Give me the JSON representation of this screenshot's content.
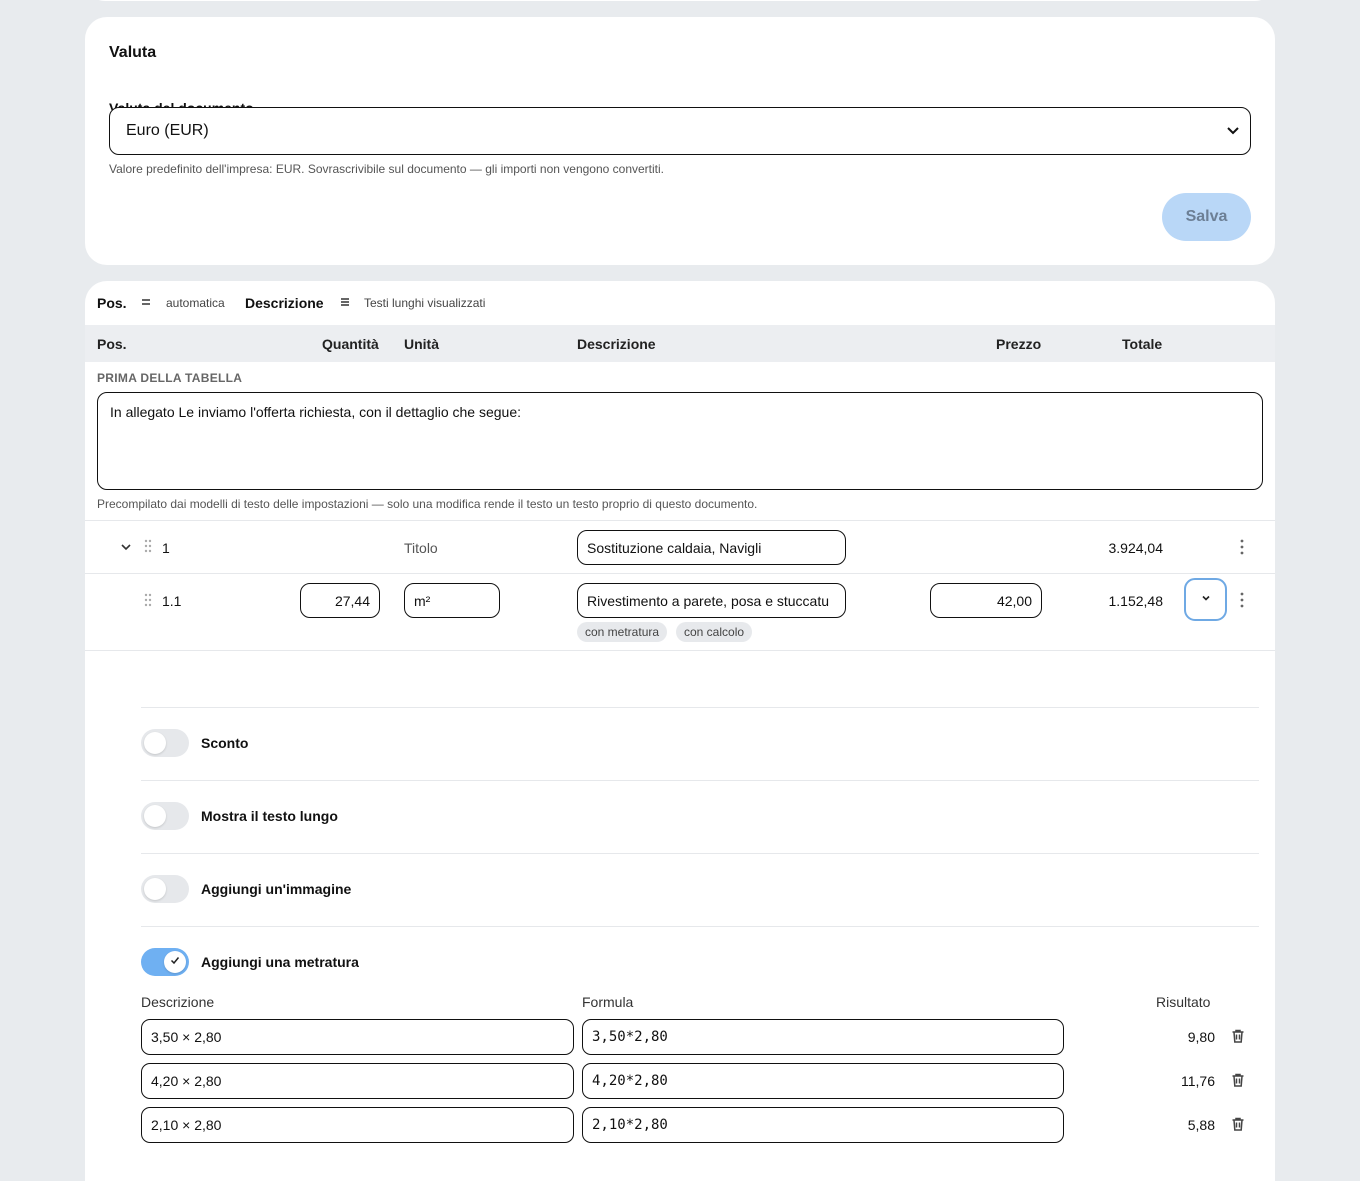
{
  "valuta": {
    "title": "Valuta",
    "field_label": "Valuta del documento",
    "selected": "Euro (EUR)",
    "hint": "Valore predefinito dell'impresa: EUR. Sovrascrivibile sul documento — gli importi non vengono convertiti.",
    "save_label": "Salva"
  },
  "toolbar": {
    "pos_label": "Pos.",
    "pos_mode": "automatica",
    "desc_label": "Descrizione",
    "desc_mode": "Testi lunghi visualizzati"
  },
  "columns": {
    "pos": "Pos.",
    "quantity": "Quantità",
    "unit": "Unità",
    "description": "Descrizione",
    "price": "Prezzo",
    "total": "Totale"
  },
  "before_table": {
    "label": "PRIMA DELLA TABELLA",
    "text": "In allegato Le inviamo l'offerta richiesta, con il dettaglio che segue:",
    "hint": "Precompilato dai modelli di testo delle impostazioni — solo una modifica rende il testo un testo proprio di questo documento."
  },
  "rows": {
    "title_row": {
      "pos": "1",
      "type": "Titolo",
      "description": "Sostituzione caldaia, Navigli",
      "total": "3.924,04"
    },
    "item_row": {
      "pos": "1.1",
      "quantity": "27,44",
      "unit": "m²",
      "description": "Rivestimento a parete, posa e stuccatu",
      "price": "42,00",
      "total": "1.152,48",
      "tags": [
        "con metratura",
        "con calcolo"
      ]
    }
  },
  "options": {
    "discount": {
      "label": "Sconto",
      "on": false
    },
    "long_text": {
      "label": "Mostra il testo lungo",
      "on": false
    },
    "image": {
      "label": "Aggiungi un'immagine",
      "on": false
    },
    "measurement": {
      "label": "Aggiungi una metratura",
      "on": true
    }
  },
  "measurement": {
    "col_description": "Descrizione",
    "col_formula": "Formula",
    "col_result": "Risultato",
    "rows": [
      {
        "description": "3,50 × 2,80",
        "formula": "3,50*2,80",
        "result": "9,80"
      },
      {
        "description": "4,20 × 2,80",
        "formula": "4,20*2,80",
        "result": "11,76"
      },
      {
        "description": "2,10 × 2,80",
        "formula": "2,10*2,80",
        "result": "5,88"
      }
    ]
  },
  "colors": {
    "accent": "#6fb0f2",
    "save_disabled_bg": "#b9d7f7",
    "page_bg": "#e8ebee"
  },
  "icons": [
    "chevron-down-icon",
    "drag-handle-icon",
    "more-vertical-icon",
    "check-icon",
    "trash-icon",
    "equals-icon",
    "lines-icon"
  ]
}
